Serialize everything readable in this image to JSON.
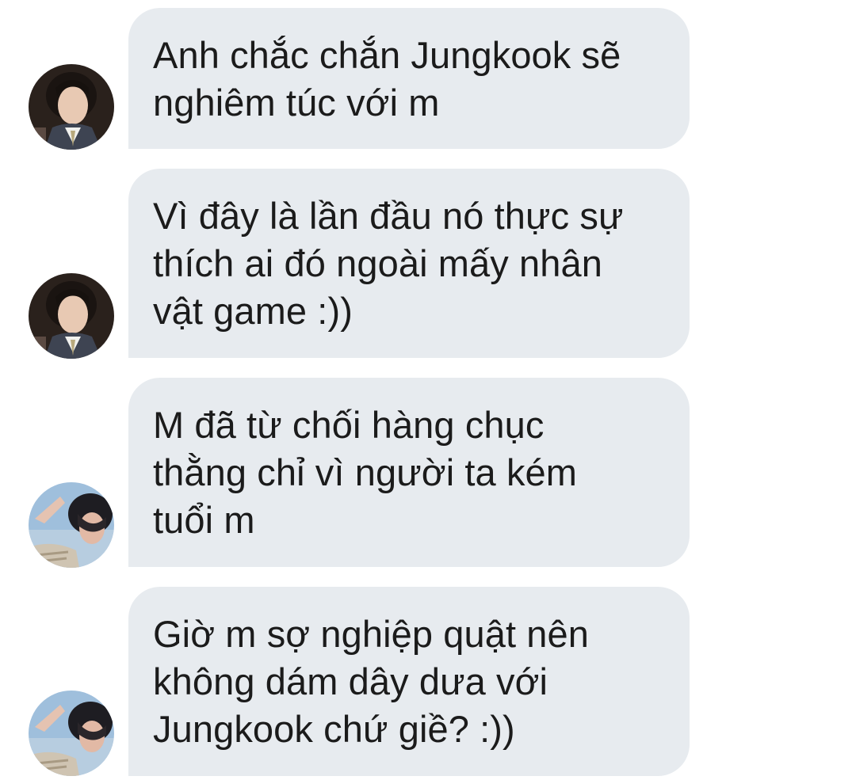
{
  "conversation": {
    "messages": [
      {
        "avatar": "avatar-dark-suit",
        "text": "Anh chắc chắn Jungkook sẽ\nnghiêm túc với m"
      },
      {
        "avatar": "avatar-dark-suit",
        "text": "Vì đây là lần đầu nó thực sự\nthích ai đó ngoài mấy nhân\nvật game :))"
      },
      {
        "avatar": "avatar-sky-hand",
        "text": "M đã từ chối hàng chục\nthằng chỉ vì người ta kém\ntuổi m"
      },
      {
        "avatar": "avatar-sky-hand",
        "text": "Giờ m sợ nghiệp quật nên\nkhông dám dây dưa với\nJungkook chứ giề? :))"
      }
    ]
  },
  "colors": {
    "bubble": "#e7ebef",
    "text": "#1b1b1b",
    "background": "#ffffff"
  }
}
